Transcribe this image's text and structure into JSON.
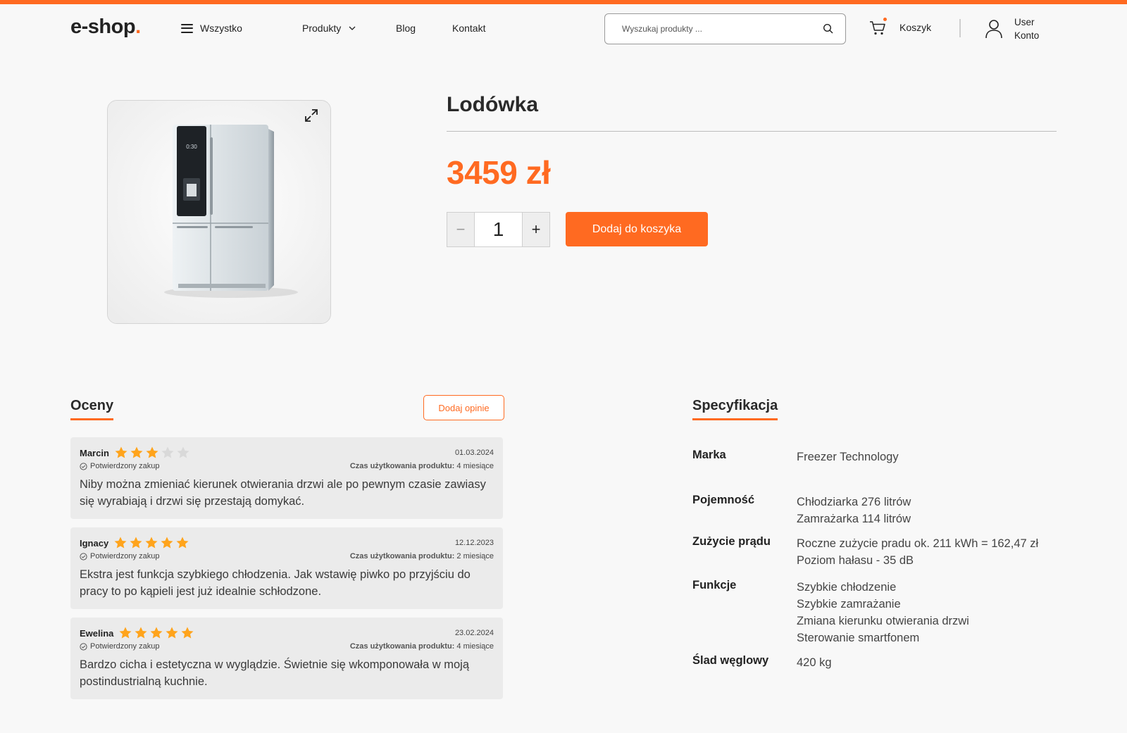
{
  "header": {
    "logo_text": "e-shop",
    "logo_dot": ".",
    "menu_all": "Wszystko",
    "nav_products": "Produkty",
    "nav_blog": "Blog",
    "nav_contact": "Kontakt",
    "search_placeholder": "Wyszukaj produkty ...",
    "cart_label": "Koszyk",
    "account_user": "User",
    "account_label": "Konto"
  },
  "product": {
    "title": "Lodówka",
    "price": "3459 zł",
    "quantity": "1",
    "minus_label": "−",
    "plus_label": "+",
    "add_to_cart": "Dodaj do koszyka",
    "display_time": "0:30"
  },
  "reviews": {
    "title": "Oceny",
    "add_button": "Dodaj opinie",
    "items": [
      {
        "name": "Marcin",
        "rating": 3,
        "date": "01.03.2024",
        "verified": "Potwierdzony zakup",
        "usage_label": "Czas użytkowania produktu:",
        "usage_value": "4 miesiące",
        "text": "Niby można zmieniać kierunek otwierania drzwi ale po pewnym czasie zawiasy się wyrabiają i drzwi się przestają domykać."
      },
      {
        "name": "Ignacy",
        "rating": 5,
        "date": "12.12.2023",
        "verified": "Potwierdzony zakup",
        "usage_label": "Czas użytkowania produktu:",
        "usage_value": "2 miesiące",
        "text": "Ekstra jest funkcja szybkiego chłodzenia. Jak wstawię piwko po przyjściu do pracy to po kąpieli jest już idealnie schłodzone."
      },
      {
        "name": "Ewelina",
        "rating": 5,
        "date": "23.02.2024",
        "verified": "Potwierdzony zakup",
        "usage_label": "Czas użytkowania produktu:",
        "usage_value": "4 miesiące",
        "text": "Bardzo cicha i estetyczna w wyglądzie. Świetnie się wkomponowała w moją postindustrialną kuchnie."
      }
    ]
  },
  "specs": {
    "title": "Specyfikacja",
    "rows": [
      {
        "key": "Marka",
        "values": [
          "Freezer Technology"
        ]
      },
      {
        "key": "Pojemność",
        "values": [
          "Chłodziarka 276 litrów",
          "Zamrażarka 114 litrów"
        ]
      },
      {
        "key": "Zużycie prądu",
        "values": [
          "Roczne zużycie pradu ok. 211 kWh = 162,47 zł",
          "Poziom hałasu - 35 dB"
        ]
      },
      {
        "key": "Funkcje",
        "values": [
          "Szybkie chłodzenie",
          "Szybkie zamrażanie",
          "Zmiana kierunku otwierania drzwi",
          "Sterowanie smartfonem"
        ]
      },
      {
        "key": "Ślad węglowy",
        "values": [
          "420 kg"
        ]
      }
    ]
  },
  "colors": {
    "accent": "#ff6a21",
    "star_on": "#ffa41c",
    "star_off": "#d9d9d9"
  }
}
